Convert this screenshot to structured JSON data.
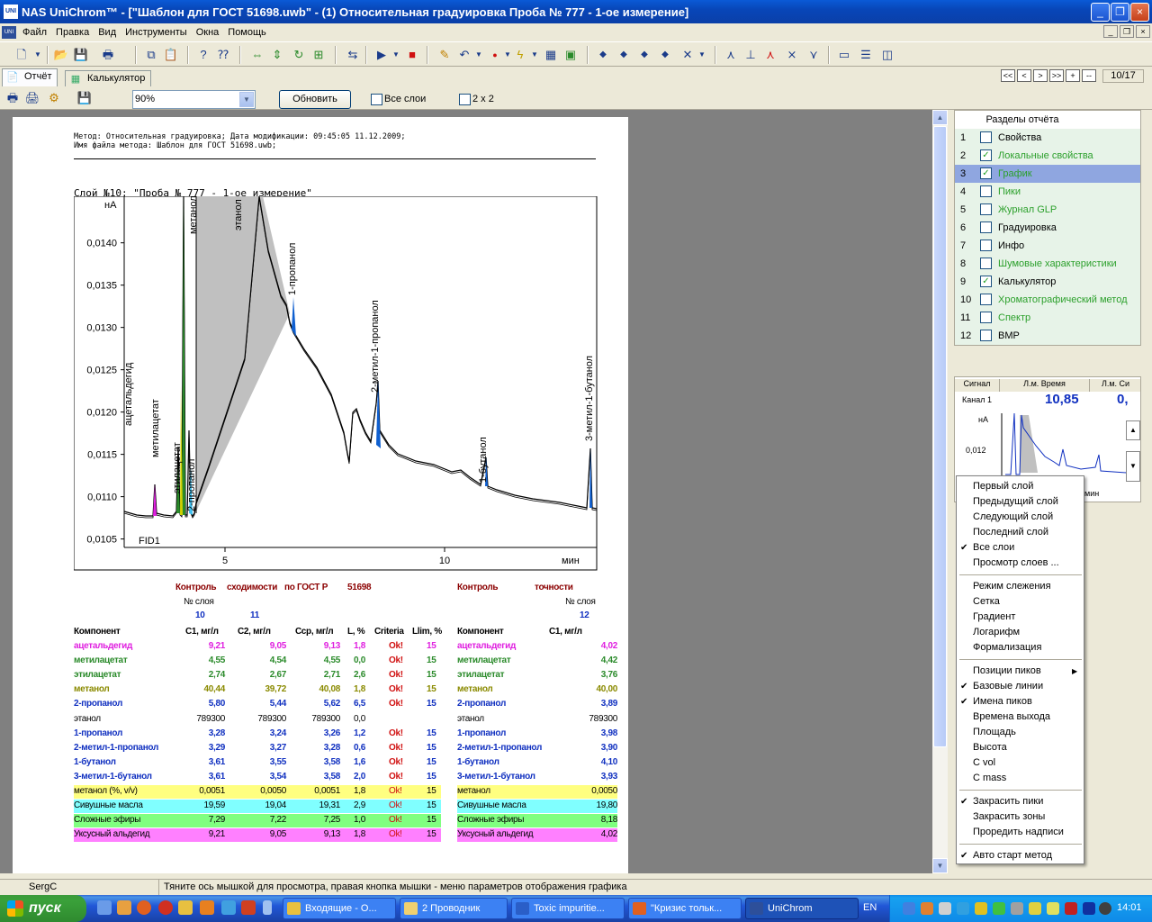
{
  "window": {
    "title": "NAS UniChrom™ - [\"Шаблон для ГОСТ 51698.uwb\" - (1) Относительная градуировка Проба № 777 - 1-ое измерение]",
    "app_icon": "UNI",
    "buttons": [
      "_",
      "❐",
      "×"
    ]
  },
  "menu": {
    "items": [
      "Файл",
      "Правка",
      "Вид",
      "Инструменты",
      "Окна",
      "Помощь"
    ],
    "mdi_controls": [
      "_",
      "❐",
      "×"
    ]
  },
  "toolbar": {
    "icons": [
      "new-icon",
      "dropdown-icon",
      "open-icon",
      "save-icon",
      "print-icon",
      "copy-icon",
      "paste-icon",
      "help-icon",
      "context-help-icon",
      "arrows-h-icon",
      "arrows-v-icon",
      "refresh-icon",
      "fit-icon",
      "link-icon",
      "play-icon",
      "play-dropdown-icon",
      "stop-icon",
      "edit-icon",
      "undo-icon",
      "undo-dropdown-icon",
      "record-icon",
      "record-dropdown-icon",
      "lightning-icon",
      "lightning-dropdown-icon",
      "calc-icon",
      "report-icon",
      "marker-left-icon",
      "marker-right-icon",
      "marker-up-icon",
      "marker-down-icon",
      "marker-x-icon",
      "marker-x-dropdown-icon",
      "peak-icon",
      "baseline-icon",
      "peak-red-icon",
      "peak-split-icon",
      "peak-merge-icon",
      "window-tile-icon",
      "window-stack-icon",
      "window-cascade-icon"
    ]
  },
  "tabs": [
    {
      "label": "Отчёт",
      "icon": "report-tab-icon"
    },
    {
      "label": "Калькулятор",
      "icon": "calc-tab-icon"
    }
  ],
  "nav": {
    "buttons": [
      "<<",
      "<",
      ">",
      ">>",
      "+",
      "--"
    ],
    "page": "10/17"
  },
  "report_toolbar": {
    "zoom_value": "90%",
    "refresh_label": "Обновить",
    "all_layers_label": "Все слои",
    "two_by_two_label": "2 x 2",
    "all_layers_checked": false,
    "two_by_two_checked": false
  },
  "report": {
    "header_line1": "Метод: Относительная градуировка; Дата модификации: 09:45:05 11.12.2009;",
    "header_line2": "Имя файла метода: Шаблон для ГОСТ 51698.uwb;",
    "layer_title": "Слой №10: \"Проба № 777 - 1-ое измерение\"",
    "detector": "FID1",
    "y_unit": "нА",
    "x_unit": "мин",
    "section1_title": [
      "Контроль",
      "сходимости",
      "по ГОСТ Р",
      "51698"
    ],
    "section2_title": [
      "Контроль",
      "точности"
    ],
    "layer_label": "№ слоя",
    "layers1": [
      "10",
      "11"
    ],
    "layers2": [
      "12"
    ],
    "cols1": [
      "Компонент",
      "C1, мг/л",
      "C2, мг/л",
      "Сср, мг/л",
      "L, %",
      "Criteria",
      "Llim, %"
    ],
    "cols2": [
      "Компонент",
      "C1, мг/л"
    ],
    "rows": [
      {
        "name": "ацетальдегид",
        "c1": "9,21",
        "c2": "9,05",
        "cavg": "9,13",
        "l": "1,8",
        "crit": "Ok!",
        "lim": "15",
        "r_name": "ацетальдегид",
        "r_c1": "4,02"
      },
      {
        "name": "метилацетат",
        "c1": "4,55",
        "c2": "4,54",
        "cavg": "4,55",
        "l": "0,0",
        "crit": "Ok!",
        "lim": "15",
        "r_name": "метилацетат",
        "r_c1": "4,42"
      },
      {
        "name": "этилацетат",
        "c1": "2,74",
        "c2": "2,67",
        "cavg": "2,71",
        "l": "2,6",
        "crit": "Ok!",
        "lim": "15",
        "r_name": "этилацетат",
        "r_c1": "3,76"
      },
      {
        "name": "метанол",
        "c1": "40,44",
        "c2": "39,72",
        "cavg": "40,08",
        "l": "1,8",
        "crit": "Ok!",
        "lim": "15",
        "r_name": "метанол",
        "r_c1": "40,00"
      },
      {
        "name": "2-пропанол",
        "c1": "5,80",
        "c2": "5,44",
        "cavg": "5,62",
        "l": "6,5",
        "crit": "Ok!",
        "lim": "15",
        "r_name": "2-пропанол",
        "r_c1": "3,89"
      },
      {
        "name": "этанол",
        "c1": "789300",
        "c2": "789300",
        "cavg": "789300",
        "l": "0,0",
        "crit": "",
        "lim": "",
        "r_name": "этанол",
        "r_c1": "789300"
      },
      {
        "name": "1-пропанол",
        "c1": "3,28",
        "c2": "3,24",
        "cavg": "3,26",
        "l": "1,2",
        "crit": "Ok!",
        "lim": "15",
        "r_name": "1-пропанол",
        "r_c1": "3,98"
      },
      {
        "name": "2-метил-1-пропанол",
        "c1": "3,29",
        "c2": "3,27",
        "cavg": "3,28",
        "l": "0,6",
        "crit": "Ok!",
        "lim": "15",
        "r_name": "2-метил-1-пропанол",
        "r_c1": "3,90"
      },
      {
        "name": "1-бутанол",
        "c1": "3,61",
        "c2": "3,55",
        "cavg": "3,58",
        "l": "1,6",
        "crit": "Ok!",
        "lim": "15",
        "r_name": "1-бутанол",
        "r_c1": "4,10"
      },
      {
        "name": "3-метил-1-бутанол",
        "c1": "3,61",
        "c2": "3,54",
        "cavg": "3,58",
        "l": "2,0",
        "crit": "Ok!",
        "lim": "15",
        "r_name": "3-метил-1-бутанол",
        "r_c1": "3,93"
      },
      {
        "name": "метанол (%, v/v)",
        "c1": "0,0051",
        "c2": "0,0050",
        "cavg": "0,0051",
        "l": "1,8",
        "crit": "Ok!",
        "lim": "15",
        "r_name": "метанол",
        "r_c1": "0,0050"
      },
      {
        "name": "Сивушные масла",
        "c1": "19,59",
        "c2": "19,04",
        "cavg": "19,31",
        "l": "2,9",
        "crit": "Ok!",
        "lim": "15",
        "r_name": "Сивушные масла",
        "r_c1": "19,80"
      },
      {
        "name": "Сложные эфиры",
        "c1": "7,29",
        "c2": "7,22",
        "cavg": "7,25",
        "l": "1,0",
        "crit": "Ok!",
        "lim": "15",
        "r_name": "Сложные эфиры",
        "r_c1": "8,18"
      },
      {
        "name": "Уксусный альдегид",
        "c1": "9,21",
        "c2": "9,05",
        "cavg": "9,13",
        "l": "1,8",
        "crit": "Ok!",
        "lim": "15",
        "r_name": "Уксусный альдегид",
        "r_c1": "4,02"
      }
    ],
    "row_colors": [
      "#e020e0",
      "#2a8a2a",
      "#2a8a2a",
      "#8a8a00",
      "#1030c0",
      "#000000",
      "#1030c0",
      "#1030c0",
      "#1030c0",
      "#1030c0",
      "#000000",
      "#000000",
      "#000000",
      "#000000"
    ],
    "row_bgs": [
      "",
      "",
      "",
      "",
      "",
      "",
      "",
      "",
      "",
      "",
      "#ffff80",
      "#80ffff",
      "#80ff80",
      "#ff80ff"
    ]
  },
  "chart_data": {
    "type": "line",
    "y_unit": "нА",
    "x_unit": "мин",
    "xlim": [
      2.9,
      9.7
    ],
    "ylim": [
      0.0104,
      0.01455
    ],
    "x_ticks": [
      5,
      10
    ],
    "y_ticks": [
      "0,0105",
      "0,0110",
      "0,0115",
      "0,0120",
      "0,0125",
      "0,0130",
      "0,0135",
      "0,0140"
    ],
    "y_tick_values": [
      0.0105,
      0.011,
      0.0115,
      0.012,
      0.0125,
      0.013,
      0.0135,
      0.014
    ],
    "peaks": [
      {
        "name": "ацетальдегид",
        "x": 3.26,
        "label_y": 0.0125
      },
      {
        "name": "метилацетат",
        "x": 3.9,
        "label_y": 0.0119
      },
      {
        "name": "этилацетат",
        "x": 4.39,
        "label_y": 0.0117
      },
      {
        "name": "метанол",
        "x": 4.53,
        "label_y": 0.0145
      },
      {
        "name": "2-пропанол",
        "x": 4.76,
        "label_y": 0.0118
      },
      {
        "name": "этанол",
        "x": 5.2,
        "label_y": 0.0145
      },
      {
        "name": "1-пропанол",
        "x": 6.58,
        "label_y": 0.0134
      },
      {
        "name": "2-метил-1-пропанол",
        "x": 8.5,
        "label_y": 0.0123
      },
      {
        "name": "1-бутанол",
        "x": 10.8,
        "label_y": 0.0117
      },
      {
        "name": "3-метил-1-бутанол",
        "x": 13.7,
        "label_y": 0.0121
      }
    ]
  },
  "sections_panel": {
    "title": "Разделы отчёта",
    "items": [
      {
        "n": "1",
        "label": "Свойства",
        "checked": false,
        "green": false
      },
      {
        "n": "2",
        "label": "Локальные свойства",
        "checked": true,
        "green": true
      },
      {
        "n": "3",
        "label": "График",
        "checked": true,
        "green": true,
        "selected": true
      },
      {
        "n": "4",
        "label": "Пики",
        "checked": false,
        "green": true
      },
      {
        "n": "5",
        "label": "Журнал GLP",
        "checked": false,
        "green": true
      },
      {
        "n": "6",
        "label": "Градуировка",
        "checked": false,
        "green": false
      },
      {
        "n": "7",
        "label": "Инфо",
        "checked": false,
        "green": false
      },
      {
        "n": "8",
        "label": "Шумовые характеристики",
        "checked": false,
        "green": true
      },
      {
        "n": "9",
        "label": "Калькулятор",
        "checked": true,
        "green": false
      },
      {
        "n": "10",
        "label": "Хроматографический метод",
        "checked": false,
        "green": true
      },
      {
        "n": "11",
        "label": "Спектр",
        "checked": false,
        "green": true
      },
      {
        "n": "12",
        "label": "ВМР",
        "checked": false,
        "green": false
      }
    ]
  },
  "mini": {
    "cols": [
      "Сигнал",
      "Л.м. Время",
      "Л.м. Си"
    ],
    "channel": "Канал 1",
    "time": "10,85",
    "value": "0,",
    "y_unit": "нА",
    "y_tick": "0,012",
    "x_unit": "мин"
  },
  "context_menu": {
    "groups": [
      [
        {
          "label": "Первый слой"
        },
        {
          "label": "Предыдущий слой"
        },
        {
          "label": "Следующий слой"
        },
        {
          "label": "Последний слой"
        },
        {
          "label": "Все слои",
          "checked": true
        },
        {
          "label": "Просмотр слоев ..."
        }
      ],
      [
        {
          "label": "Режим слежения"
        },
        {
          "label": "Сетка"
        },
        {
          "label": "Градиент"
        },
        {
          "label": "Логарифм"
        },
        {
          "label": "Формализация"
        }
      ],
      [
        {
          "label": "Позиции пиков",
          "submenu": true
        },
        {
          "label": "Базовые линии",
          "checked": true
        },
        {
          "label": "Имена пиков",
          "checked": true
        },
        {
          "label": "Времена выхода"
        },
        {
          "label": "Площадь"
        },
        {
          "label": "Высота"
        },
        {
          "label": "C vol"
        },
        {
          "label": "C mass"
        }
      ],
      [
        {
          "label": "Закрасить пики",
          "checked": true
        },
        {
          "label": "Закрасить зоны"
        },
        {
          "label": "Проредить надписи"
        }
      ],
      [
        {
          "label": "Авто старт метод",
          "checked": true
        }
      ]
    ]
  },
  "status": {
    "user": "SergC",
    "hint": "Тяните ось мышкой для просмотра, правая кнопка мышки - меню параметров отображения графика"
  },
  "taskbar": {
    "start": "пуск",
    "tasks": [
      {
        "label": "Входящие - О...",
        "color": "#e8c040"
      },
      {
        "label": "2 Проводник",
        "color": "#f0d070"
      },
      {
        "label": "Toxic impuritie...",
        "color": "#2a5ec8"
      },
      {
        "label": "\"Кризис тольк...",
        "color": "#e06020"
      },
      {
        "label": "UniChrom",
        "color": "#2d4f9a",
        "active": true
      }
    ],
    "lang": "EN",
    "clock": "14:01"
  }
}
